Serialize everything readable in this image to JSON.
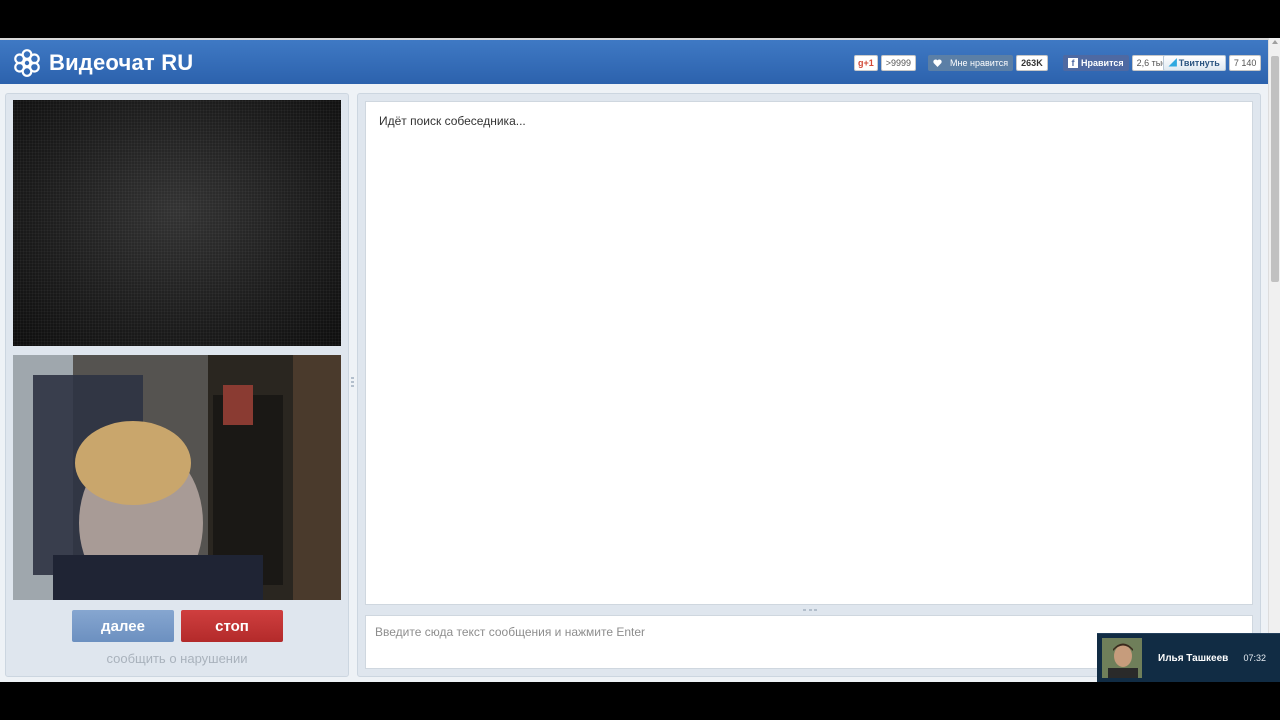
{
  "header": {
    "title": "Видеочат RU",
    "social": {
      "gplus_label": "g+1",
      "gplus_count": ">9999",
      "vk_label": "Мне нравится",
      "vk_count": "263K",
      "fb_label": "Нравится",
      "fb_count": "2,6 тыс",
      "tw_label": "Твитнуть",
      "tw_count": "7 140"
    }
  },
  "video": {
    "next_label": "далее",
    "stop_label": "стоп",
    "report_label": "сообщить о нарушении"
  },
  "chat": {
    "status": "Идёт поиск собеседника...",
    "input_placeholder": "Введите сюда текст сообщения и нажмите Enter",
    "input_value": ""
  },
  "notification": {
    "name": "Илья Ташкеев",
    "time": "07:32"
  },
  "colors": {
    "header_blue": "#2c62ad",
    "next_button": "#6c90c0",
    "stop_button": "#b32a2a"
  }
}
